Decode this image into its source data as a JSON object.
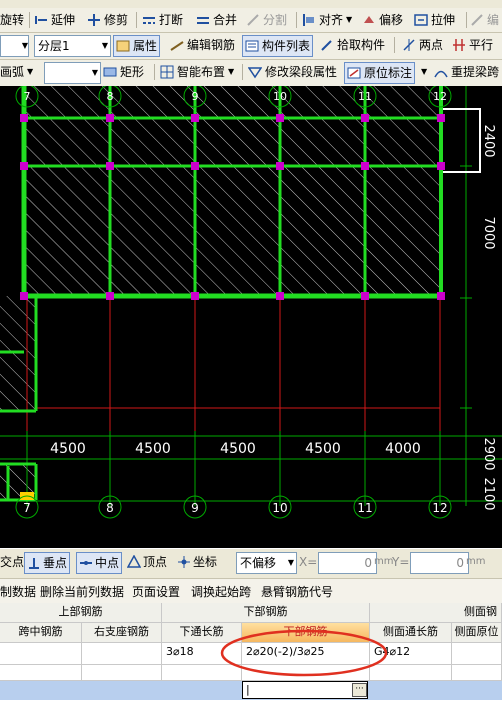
{
  "toolbar1": {
    "rotate": "旋转",
    "extend": "延伸",
    "trim": "修剪",
    "break": "打断",
    "merge": "合并",
    "split": "分割",
    "align": "对齐",
    "offset": "偏移",
    "stretch": "拉伸",
    "edit": "编"
  },
  "toolbar2": {
    "first_select": "",
    "layer_select": "分层1",
    "properties": "属性",
    "edit_rebar": "编辑钢筋",
    "component_list": "构件列表",
    "pick_component": "拾取构件",
    "two_points": "两点",
    "parallel": "平行"
  },
  "toolbar3": {
    "arc": "画弧",
    "blank_select": "",
    "rect": "矩形",
    "smart_layout": "智能布置",
    "modify_beam_props": "修改梁段属性",
    "in_situ_label": "原位标注",
    "lift_rebar": "重提梁跨"
  },
  "drawing": {
    "axis_labels": [
      "7",
      "8",
      "9",
      "10",
      "11",
      "12"
    ],
    "span_dims": [
      "4500",
      "4500",
      "4500",
      "4500",
      "4000"
    ],
    "vert_dims": [
      "2400",
      "7000",
      "2900",
      "2100"
    ],
    "colors": {
      "beam": "#22dd22",
      "node": "#cc00cc",
      "axis": "#d01818",
      "grid": "#00aa00",
      "highlight": "#ffffff",
      "text": "#ffffff"
    }
  },
  "snapbar": {
    "intersect": "交点",
    "perpendicular": "垂点",
    "midpoint": "中点",
    "vertex": "顶点",
    "coord": "坐标",
    "offset_mode": "不偏移",
    "x_label": "X=",
    "x_value": "0",
    "unit1": "mm",
    "y_label": "Y=",
    "y_value": "0",
    "unit2": "mm"
  },
  "gridbar": {
    "copy_data": "制数据",
    "delete_col": "删除当前列数据",
    "page_setup": "页面设置",
    "adjust_start": "调换起始跨",
    "cantilever_code": "悬臂钢筋代号"
  },
  "table": {
    "group_top": "上部钢筋",
    "group_bottom": "下部钢筋",
    "group_side": "侧面钢",
    "headers": [
      "跨中钢筋",
      "右支座钢筋",
      "下通长筋",
      "下部钢筋",
      "侧面通长筋",
      "侧面原位"
    ],
    "row1": [
      "",
      "",
      "3⌀18",
      "2⌀20(-2)/3⌀25",
      "G4⌀12",
      ""
    ],
    "edit_value": "|"
  }
}
